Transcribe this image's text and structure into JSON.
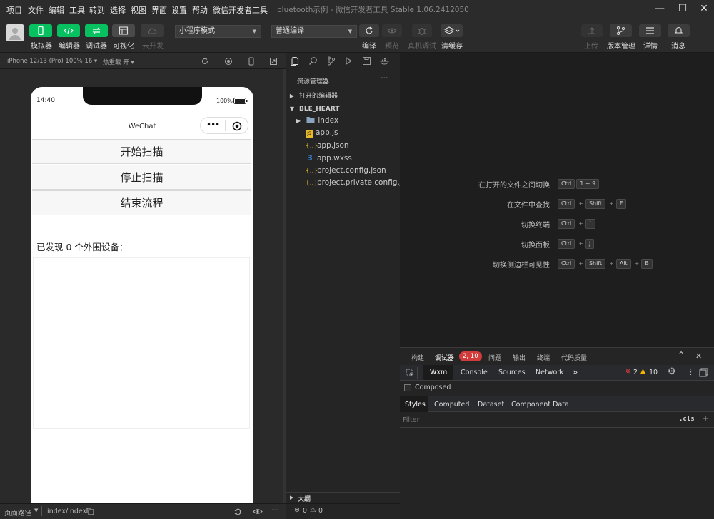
{
  "menu": [
    "项目",
    "文件",
    "编辑",
    "工具",
    "转到",
    "选择",
    "视图",
    "界面",
    "设置",
    "帮助",
    "微信开发者工具"
  ],
  "window_title": "bluetooth示例 - 微信开发者工具 Stable 1.06.2412050",
  "toolbar": {
    "simulator": "模拟器",
    "editor": "编辑器",
    "debugger": "调试器",
    "visual": "可视化",
    "cloud": "云开发",
    "mode": "小程序模式",
    "compile_mode": "普通编译",
    "compile": "编译",
    "preview": "预览",
    "real_debug": "真机调试",
    "clear_cache": "清缓存",
    "upload": "上传",
    "version": "版本管理",
    "details": "详情",
    "messages": "消息"
  },
  "sim_header": {
    "device": "iPhone 12/13 (Pro) 100% 16 ▾",
    "hot_reload": "热重载 开 ▾"
  },
  "phone": {
    "time": "14:40",
    "battery": "100%",
    "nav_title": "WeChat",
    "buttons": [
      "开始扫描",
      "停止扫描",
      "结束流程"
    ],
    "found_text": "已发现 0 个外围设备："
  },
  "status_bar": {
    "page_path_label": "页面路径",
    "page_path": "index/index",
    "errors": "0",
    "warnings": "0"
  },
  "explorer": {
    "title": "资源管理器",
    "open_editors": "打开的编辑器",
    "project": "BLE_HEART",
    "files": [
      {
        "name": "index",
        "icon": "folder-icon"
      },
      {
        "name": "app.js",
        "icon": "js-file-icon"
      },
      {
        "name": "app.json",
        "icon": "json-file-icon"
      },
      {
        "name": "app.wxss",
        "icon": "css-file-icon"
      },
      {
        "name": "project.config.json",
        "icon": "json-file-icon"
      },
      {
        "name": "project.private.config.js...",
        "icon": "json-file-icon"
      }
    ],
    "outline": "大纲"
  },
  "shortcuts": [
    {
      "label": "在打开的文件之间切换",
      "keys": [
        "Ctrl",
        "1 ~ 9"
      ]
    },
    {
      "label": "在文件中查找",
      "keys": [
        "Ctrl",
        "Shift",
        "F"
      ]
    },
    {
      "label": "切换终端",
      "keys": [
        "Ctrl",
        "`"
      ]
    },
    {
      "label": "切换面板",
      "keys": [
        "Ctrl",
        "J"
      ]
    },
    {
      "label": "切换侧边栏可见性",
      "keys": [
        "Ctrl",
        "Shift",
        "Alt",
        "B"
      ]
    }
  ],
  "debug": {
    "tabs": [
      "构建",
      "调试器",
      "问题",
      "输出",
      "终端",
      "代码质量"
    ],
    "badge": "2, 10",
    "devtools_tabs": [
      "Wxml",
      "Console",
      "Sources",
      "Network"
    ],
    "more": "»",
    "error_count": "2",
    "warn_count": "10",
    "composed": "Composed",
    "style_tabs": [
      "Styles",
      "Computed",
      "Dataset",
      "Component Data"
    ],
    "filter_placeholder": "Filter",
    "cls": ".cls",
    "plus": "+"
  }
}
